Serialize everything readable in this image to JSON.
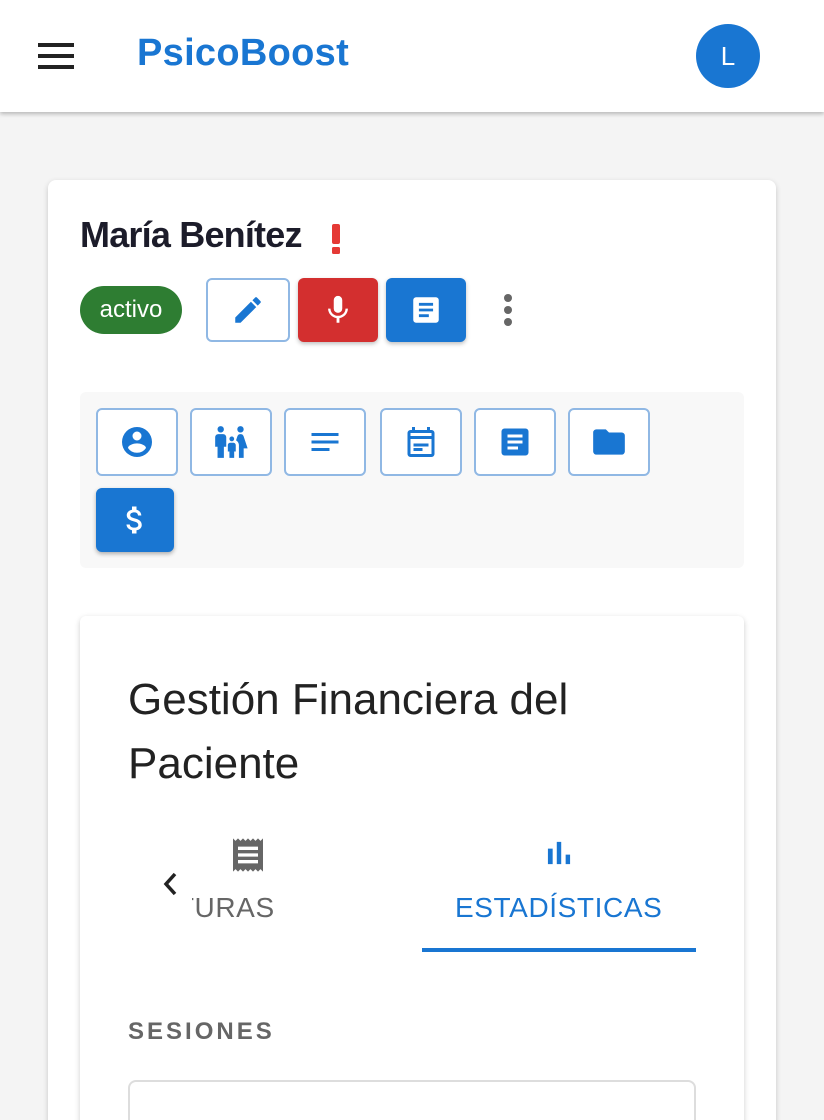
{
  "app": {
    "brand": "PsicoBoost",
    "user_initial": "L"
  },
  "patient": {
    "name": "María Benítez",
    "status": "activo"
  },
  "section": {
    "title": "Gestión Financiera del Paciente",
    "tabs": [
      {
        "label": "FACTURAS",
        "icon": "receipt-icon",
        "visible_text": "CTURAS"
      },
      {
        "label": "ESTADÍSTICAS",
        "icon": "bar-chart-icon",
        "selected": true
      }
    ],
    "subheading": "SESIONES"
  },
  "colors": {
    "primary": "#1976d2",
    "danger": "#d32f2f",
    "success": "#2e7d32",
    "alert": "#e53935"
  }
}
